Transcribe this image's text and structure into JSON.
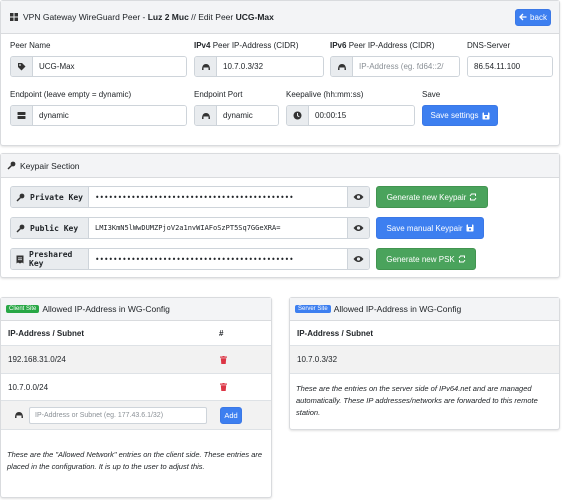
{
  "header": {
    "title_prefix": "VPN Gateway WireGuard Peer - ",
    "gateway": "Luz 2 Muc",
    "separator": " // ",
    "edit_label": "Edit Peer ",
    "peer": "UCG-Max",
    "back_label": "back"
  },
  "form": {
    "peer_name_label": "Peer Name",
    "peer_name_value": "UCG-Max",
    "ipv4_label_bold": "IPv4",
    "ipv4_label_rest": " Peer IP-Address (CIDR)",
    "ipv4_value": "10.7.0.3/32",
    "ipv6_label_bold": "IPv6",
    "ipv6_label_rest": " Peer IP-Address (CIDR)",
    "ipv6_placeholder": "IP-Address (eg. fd64::2/",
    "dns_label": "DNS-Server",
    "dns_value": "86.54.11.100",
    "endpoint_label": "Endpoint (leave empty = dynamic)",
    "endpoint_value": "dynamic",
    "endpoint_port_label": "Endpoint Port",
    "endpoint_port_value": "dynamic",
    "keepalive_label": "Keepalive (hh:mm:ss)",
    "keepalive_value": "00:00:15",
    "save_label": "Save",
    "save_button": "Save settings"
  },
  "keypair": {
    "section_title": "Keypair Section",
    "private_label": "Private Key",
    "private_value": "••••••••••••••••••••••••••••••••••••••••••••",
    "generate_keypair": "Generate new Keypair",
    "public_label": "Public Key",
    "public_value": "LMI3KmN5lWwDUMZPjoV2a1nvWIAFoSzPT5Sq7GGeXRA=",
    "save_manual_keypair": "Save manual Keypair",
    "psk_label": "Preshared Key",
    "psk_value": "••••••••••••••••••••••••••••••••••••••••••••",
    "generate_psk": "Generate new PSK"
  },
  "client_site": {
    "badge": "Client Site",
    "title": "Allowed IP-Address in WG-Config",
    "col_subnet": "IP-Address / Subnet",
    "col_hash": "#",
    "rows": [
      "192.168.31.0/24",
      "10.7.0.0/24"
    ],
    "add_placeholder": "IP-Address or Subnet (eg. 177.43.6.1/32)",
    "add_button": "Add",
    "note": "These are the \"Allowed Network\" entries on the client side. These entries are placed in the configuration. It is up to the user to adjust this."
  },
  "server_site": {
    "badge": "Server Site",
    "title": "Allowed IP-Address in WG-Config",
    "col_subnet": "IP-Address / Subnet",
    "rows": [
      "10.7.0.3/32"
    ],
    "note": "These are the entries on the server side of IPv64.net and are managed automatically. These IP addresses/networks are forwarded to this remote station."
  },
  "colors": {
    "primary": "#3d7ff0",
    "success": "#4aa35c",
    "danger": "#dc3545",
    "client_badge": "#28a745",
    "server_badge": "#3d7ff0"
  }
}
